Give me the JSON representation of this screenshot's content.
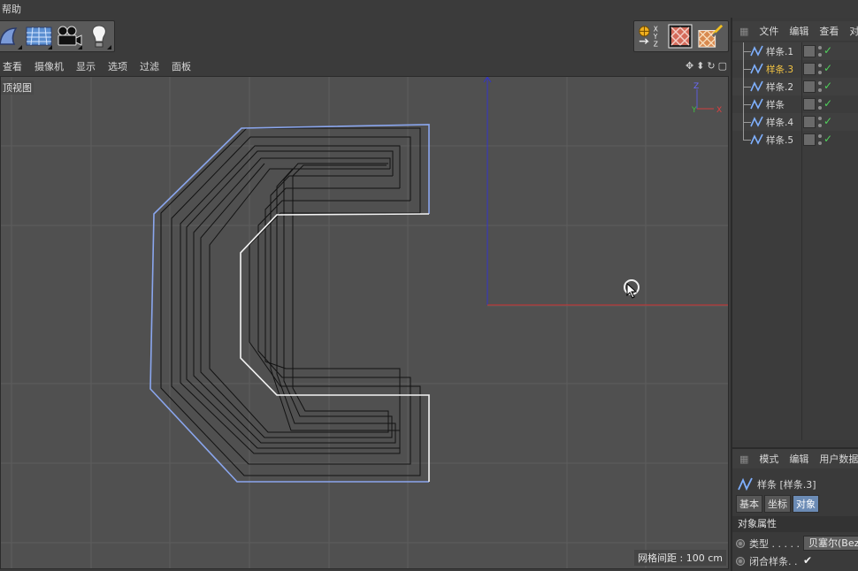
{
  "menubar": {
    "help": "帮助"
  },
  "viewport_menu": {
    "items": [
      "查看",
      "摄像机",
      "显示",
      "选项",
      "过滤",
      "面板"
    ]
  },
  "viewport": {
    "label": "顶视图",
    "grid_info": "网格间距 : 100 cm",
    "axis": {
      "z": "Z",
      "y": "Y",
      "x": "X"
    }
  },
  "object_manager": {
    "tabs": [
      "文件",
      "编辑",
      "查看",
      "对"
    ],
    "objects": [
      {
        "name": "样条.1",
        "selected": false
      },
      {
        "name": "样条.3",
        "selected": true
      },
      {
        "name": "样条.2",
        "selected": false
      },
      {
        "name": "样条",
        "selected": false
      },
      {
        "name": "样条.4",
        "selected": false
      },
      {
        "name": "样条.5",
        "selected": false
      }
    ]
  },
  "attribute_manager": {
    "tabs": [
      "模式",
      "编辑",
      "用户数据"
    ],
    "title": "样条 [样条.3]",
    "sub_tabs": [
      "基本",
      "坐标",
      "对象"
    ],
    "active_sub_tab": "对象",
    "section": "对象属性",
    "type_label": "类型 . . . . .",
    "type_value": "贝塞尔(Bezier)",
    "closed_label": "闭合样条. .",
    "closed_value": "✔"
  },
  "colors": {
    "selected_text": "#f3c443",
    "check": "#4fd05a",
    "active_tab": "#6b8bb5",
    "x_axis": "#d23030",
    "y_axis": "#3030c8"
  }
}
